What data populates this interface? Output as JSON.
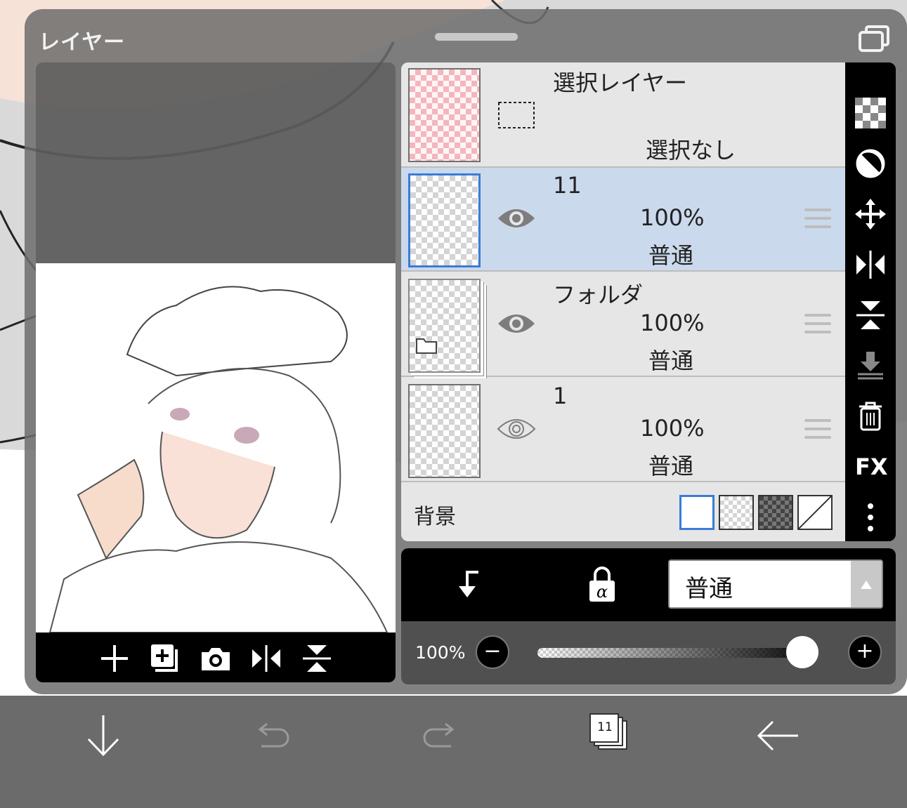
{
  "panel": {
    "title": "レイヤー"
  },
  "layers": [
    {
      "name": "選択レイヤー",
      "status": "選択なし",
      "thumb": "pink-checker"
    },
    {
      "name": "11",
      "opacity": "100%",
      "mode": "普通",
      "visible": true,
      "selected": true
    },
    {
      "name": "フォルダ",
      "opacity": "100%",
      "mode": "普通",
      "visible": true,
      "folder": true
    },
    {
      "name": "1",
      "opacity": "100%",
      "mode": "普通",
      "visible": true
    }
  ],
  "background": {
    "label": "背景",
    "options": [
      "white",
      "checker-light",
      "checker-dark",
      "none"
    ],
    "selected": "white"
  },
  "side_icons": [
    "checker-icon",
    "contrast-icon",
    "move-icon",
    "flip-horizontal-icon",
    "flip-vertical-icon",
    "merge-down-icon",
    "trash-icon",
    "fx-icon",
    "more-icon"
  ],
  "side_fx_label": "FX",
  "mode_bar": {
    "blend_mode": "普通",
    "clip_icon": "clip-arrow-icon",
    "alpha_lock_icon": "alpha-lock-icon"
  },
  "opacity": {
    "label": "100%",
    "minus": "−",
    "plus": "+",
    "value": 1.0
  },
  "bottom_bar": {
    "layer_count": "11"
  },
  "colors": {
    "accent": "#3a7cd6",
    "selected_row": "#cbd9ec",
    "panel_bg": "#6e6e6e"
  }
}
